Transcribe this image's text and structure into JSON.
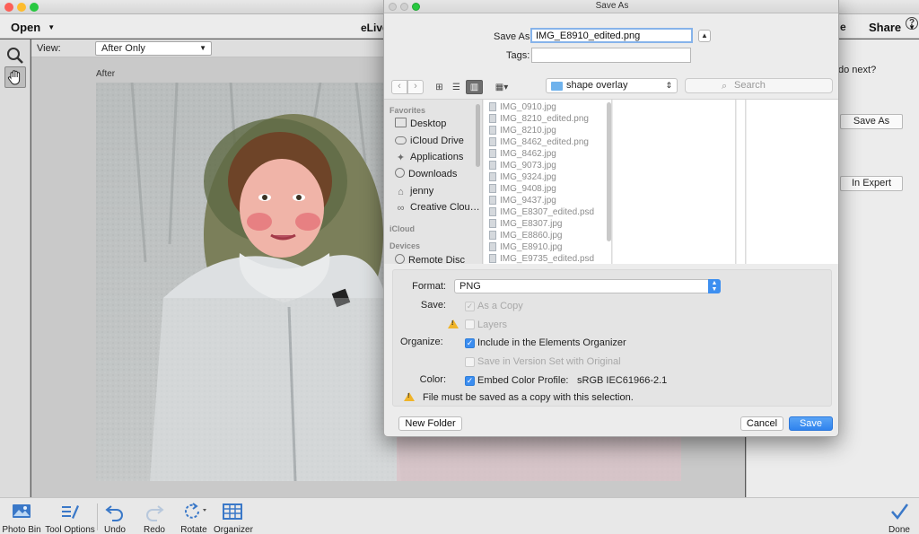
{
  "app": {
    "menu_open": "Open",
    "app_name": "eLive",
    "right_partial": "e",
    "menu_share": "Share",
    "help": "?"
  },
  "view_bar": {
    "label": "View:",
    "selected": "After Only"
  },
  "canvas": {
    "after_label": "After"
  },
  "right_panel": {
    "prompt": "do next?",
    "save_as_btn": "Save As",
    "in_expert_btn": "In Expert"
  },
  "bottom_bar": {
    "photo_bin": "Photo Bin",
    "tool_options": "Tool Options",
    "undo": "Undo",
    "redo": "Redo",
    "rotate": "Rotate",
    "organizer": "Organizer",
    "done": "Done"
  },
  "dialog": {
    "title": "Save As",
    "save_as_label": "Save As:",
    "filename": "IMG_E8910_edited.png",
    "tags_label": "Tags:",
    "tags_value": "",
    "location": "shape overlay",
    "search_placeholder": "Search",
    "sidebar": {
      "favorites_header": "Favorites",
      "items": [
        "Desktop",
        "iCloud Drive",
        "Applications",
        "Downloads",
        "jenny",
        "Creative Clou…"
      ],
      "icloud_header": "iCloud",
      "devices_header": "Devices",
      "device_item": "Remote Disc"
    },
    "files": [
      "IMG_0910.jpg",
      "IMG_8210_edited.png",
      "IMG_8210.jpg",
      "IMG_8462_edited.png",
      "IMG_8462.jpg",
      "IMG_9073.jpg",
      "IMG_9324.jpg",
      "IMG_9408.jpg",
      "IMG_9437.jpg",
      "IMG_E8307_edited.psd",
      "IMG_E8307.jpg",
      "IMG_E8860.jpg",
      "IMG_E8910.jpg",
      "IMG_E9735_edited.psd"
    ],
    "options": {
      "format_label": "Format:",
      "format_value": "PNG",
      "save_label": "Save:",
      "as_a_copy": "As a Copy",
      "layers": "Layers",
      "organize_label": "Organize:",
      "include_organizer": "Include in the Elements Organizer",
      "version_set": "Save in Version Set with Original",
      "color_label": "Color:",
      "embed_profile": "Embed Color Profile:",
      "profile_name": "sRGB IEC61966-2.1",
      "warning": "File must be saved as a copy with this selection."
    },
    "new_folder_btn": "New Folder",
    "cancel_btn": "Cancel",
    "save_btn": "Save"
  },
  "colors": {
    "accent": "#3b8df0",
    "warning": "#f0b429"
  }
}
